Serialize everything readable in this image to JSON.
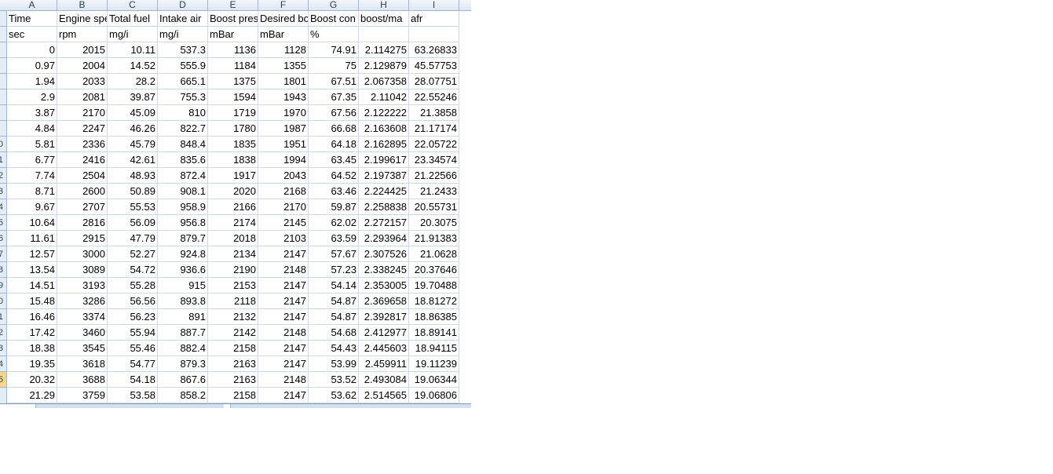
{
  "spreadsheet": {
    "column_letters": [
      "A",
      "B",
      "C",
      "D",
      "E",
      "F",
      "G",
      "H",
      "I"
    ],
    "header_row": [
      "Time",
      "Engine spе",
      "Total fuel",
      "Intake air",
      "Boost pres",
      "Desired bо",
      "Boost con",
      "boost/ma",
      "afr"
    ],
    "unit_row": [
      "sec",
      "rpm",
      "mg/i",
      "mg/i",
      "mBar",
      "mBar",
      "%",
      "",
      ""
    ],
    "row_numbers": [
      "",
      "",
      "",
      "",
      "",
      "",
      "",
      "",
      "0",
      "1",
      "2",
      "3",
      "4",
      "5",
      "6",
      "7",
      "8",
      "9",
      "0",
      "1",
      "2",
      "3",
      "4",
      "5"
    ],
    "rows": [
      [
        "0",
        "2015",
        "10.11",
        "537.3",
        "1136",
        "1128",
        "74.91",
        "2.114275",
        "63.26833"
      ],
      [
        "0.97",
        "2004",
        "14.52",
        "555.9",
        "1184",
        "1355",
        "75",
        "2.129879",
        "45.57753"
      ],
      [
        "1.94",
        "2033",
        "28.2",
        "665.1",
        "1375",
        "1801",
        "67.51",
        "2.067358",
        "28.07751"
      ],
      [
        "2.9",
        "2081",
        "39.87",
        "755.3",
        "1594",
        "1943",
        "67.35",
        "2.11042",
        "22.55246"
      ],
      [
        "3.87",
        "2170",
        "45.09",
        "810",
        "1719",
        "1970",
        "67.56",
        "2.122222",
        "21.3858"
      ],
      [
        "4.84",
        "2247",
        "46.26",
        "822.7",
        "1780",
        "1987",
        "66.68",
        "2.163608",
        "21.17174"
      ],
      [
        "5.81",
        "2336",
        "45.79",
        "848.4",
        "1835",
        "1951",
        "64.18",
        "2.162895",
        "22.05722"
      ],
      [
        "6.77",
        "2416",
        "42.61",
        "835.6",
        "1838",
        "1994",
        "63.45",
        "2.199617",
        "23.34574"
      ],
      [
        "7.74",
        "2504",
        "48.93",
        "872.4",
        "1917",
        "2043",
        "64.52",
        "2.197387",
        "21.22566"
      ],
      [
        "8.71",
        "2600",
        "50.89",
        "908.1",
        "2020",
        "2168",
        "63.46",
        "2.224425",
        "21.2433"
      ],
      [
        "9.67",
        "2707",
        "55.53",
        "958.9",
        "2166",
        "2170",
        "59.87",
        "2.258838",
        "20.55731"
      ],
      [
        "10.64",
        "2816",
        "56.09",
        "956.8",
        "2174",
        "2145",
        "62.02",
        "2.272157",
        "20.3075"
      ],
      [
        "11.61",
        "2915",
        "47.79",
        "879.7",
        "2018",
        "2103",
        "63.59",
        "2.293964",
        "21.91383"
      ],
      [
        "12.57",
        "3000",
        "52.27",
        "924.8",
        "2134",
        "2147",
        "57.67",
        "2.307526",
        "21.0628"
      ],
      [
        "13.54",
        "3089",
        "54.72",
        "936.6",
        "2190",
        "2148",
        "57.23",
        "2.338245",
        "20.37646"
      ],
      [
        "14.51",
        "3193",
        "55.28",
        "915",
        "2153",
        "2147",
        "54.14",
        "2.353005",
        "19.70488"
      ],
      [
        "15.48",
        "3286",
        "56.56",
        "893.8",
        "2118",
        "2147",
        "54.87",
        "2.369658",
        "18.81272"
      ],
      [
        "16.46",
        "3374",
        "56.23",
        "891",
        "2132",
        "2147",
        "54.87",
        "2.392817",
        "18.86385"
      ],
      [
        "17.42",
        "3460",
        "55.94",
        "887.7",
        "2142",
        "2148",
        "54.68",
        "2.412977",
        "18.89141"
      ],
      [
        "18.38",
        "3545",
        "55.46",
        "882.4",
        "2158",
        "2147",
        "54.43",
        "2.445603",
        "18.94115"
      ],
      [
        "19.35",
        "3618",
        "54.77",
        "879.3",
        "2163",
        "2147",
        "53.99",
        "2.459911",
        "19.11239"
      ],
      [
        "20.32",
        "3688",
        "54.18",
        "867.6",
        "2163",
        "2148",
        "53.52",
        "2.493084",
        "19.06344"
      ],
      [
        "21.29",
        "3759",
        "53.58",
        "858.2",
        "2158",
        "2147",
        "53.62",
        "2.514565",
        "19.06806"
      ]
    ]
  }
}
